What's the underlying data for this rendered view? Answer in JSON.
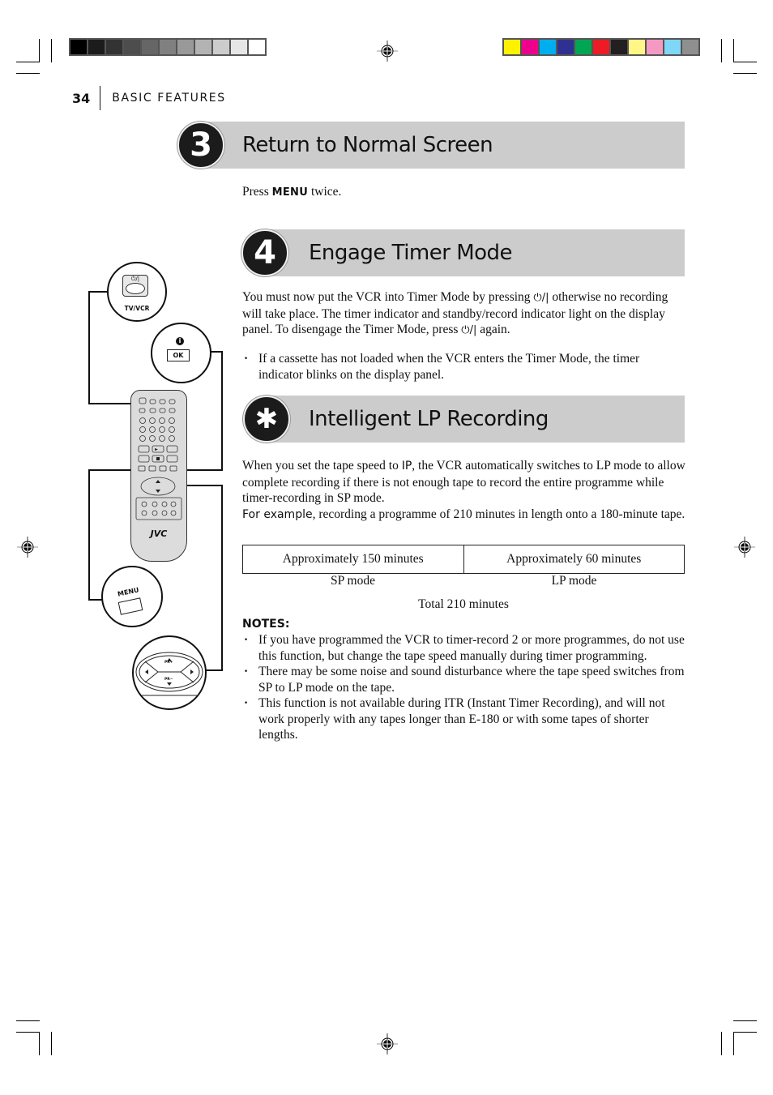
{
  "header": {
    "page_number": "34",
    "section": "BASIC FEATURES"
  },
  "print_marks": {
    "gray_swatches": [
      "#000000",
      "#1c1c1c",
      "#333333",
      "#4d4d4d",
      "#666666",
      "#808080",
      "#999999",
      "#b3b3b3",
      "#cccccc",
      "#e6e6e6",
      "#ffffff"
    ],
    "color_swatches": [
      "#fff200",
      "#ec008c",
      "#00aeef",
      "#2e3192",
      "#00a651",
      "#ed1c24",
      "#231f20",
      "#fff685",
      "#f49ac2",
      "#7fd6f7",
      "#8f8f8f"
    ]
  },
  "steps": [
    {
      "badge": "3",
      "title": "Return to Normal Screen",
      "instruction": {
        "before": "Press ",
        "key": "MENU",
        "after": " twice."
      }
    },
    {
      "badge": "4",
      "title": "Engage Timer Mode",
      "paragraph": {
        "p1": "You must now put the VCR into Timer Mode by pressing ",
        "power_symbol": "⏻/|",
        "p2": " otherwise no recording will take place. The timer indicator and standby/record indicator light on the display panel. To disengage the Timer Mode, press ",
        "p3": " again."
      },
      "bullets": [
        "If a cassette has not loaded when the VCR enters the Timer Mode, the timer indicator blinks on the display panel."
      ]
    },
    {
      "badge": "✱",
      "title": "Intelligent LP Recording",
      "paragraph": {
        "p1": "When you set the tape speed to ",
        "key": "IP",
        "p2": ", the VCR automatically switches to LP mode to allow complete recording if there is not enough tape to record the entire programme while timer-recording in SP mode."
      },
      "example": {
        "label": "For example",
        "text": ", recording a programme of 210 minutes in length onto a 180-minute tape."
      },
      "table": {
        "cells": [
          "Approximately 150 minutes",
          "Approximately 60 minutes"
        ],
        "captions": [
          "SP mode",
          "LP mode"
        ],
        "total": "Total 210 minutes"
      },
      "notes": {
        "heading": "NOTES:",
        "items": [
          "If you have programmed the VCR to timer-record 2 or more programmes, do not use this function, but change the tape speed manually during timer programming.",
          "There may be some noise and sound disturbance where the tape speed switches from SP to LP mode on the tape.",
          "This function is not available during ITR (Instant Timer Recording), and will not work properly with any tapes longer than E-180 or with some tapes of shorter lengths."
        ]
      }
    }
  ],
  "remote_illustration": {
    "brand": "JVC",
    "callouts": {
      "power": {
        "symbol": "⏻/|",
        "label": "TV/VCR"
      },
      "ok": {
        "info": "i",
        "label": "OK"
      },
      "menu": {
        "label": "MENU"
      },
      "dpad": {
        "up": "PR+",
        "down": "PR−"
      }
    }
  }
}
